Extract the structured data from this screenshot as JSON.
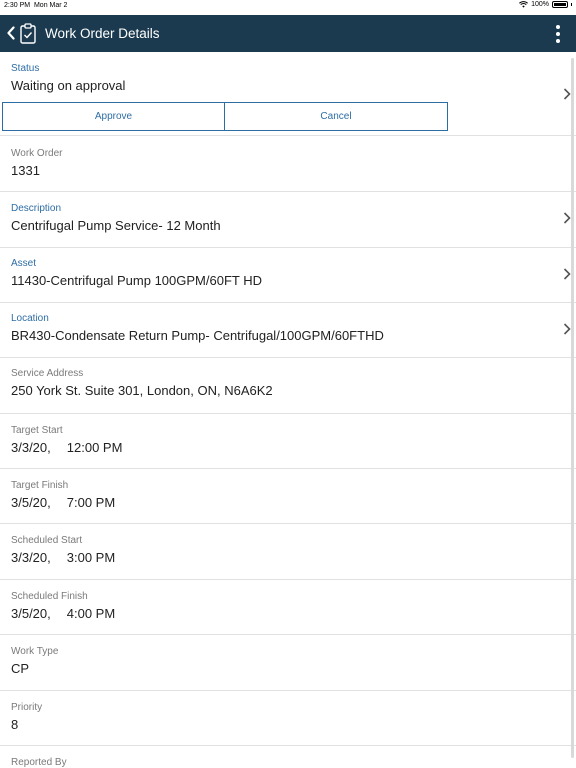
{
  "statusbar": {
    "time": "2:30 PM",
    "date": "Mon Mar 2",
    "battery": "100%"
  },
  "header": {
    "title": "Work Order Details",
    "back_icon": "chevron-left-icon",
    "page_icon": "clipboard-check-icon",
    "menu_icon": "more-vertical-icon"
  },
  "status": {
    "label": "Status",
    "value": "Waiting on approval",
    "approve_label": "Approve",
    "cancel_label": "Cancel"
  },
  "fields": [
    {
      "label": "Work Order",
      "value": "1331"
    },
    {
      "label": "Description",
      "value": "Centrifugal Pump Service- 12 Month"
    },
    {
      "label": "Asset",
      "value": "11430-Centrifugal Pump 100GPM/60FT HD"
    },
    {
      "label": "Location",
      "value": "BR430-Condensate Return Pump- Centrifugal/100GPM/60FTHD"
    },
    {
      "label": "Service Address",
      "value": "250 York St. Suite 301, London, ON, N6A6K2"
    },
    {
      "label": "Target Start",
      "date": "3/3/20,",
      "time": "12:00 PM"
    },
    {
      "label": "Target Finish",
      "date": "3/5/20,",
      "time": "7:00 PM"
    },
    {
      "label": "Scheduled Start",
      "date": "3/3/20,",
      "time": "3:00 PM"
    },
    {
      "label": "Scheduled Finish",
      "date": "3/5/20,",
      "time": "4:00 PM"
    },
    {
      "label": "Work Type",
      "value": "CP"
    },
    {
      "label": "Priority",
      "value": "8"
    },
    {
      "label": "Reported By",
      "value": ""
    }
  ],
  "colors": {
    "header_bg": "#1b3a4f",
    "accent": "#2e6da4",
    "divider": "#e1e1e1"
  }
}
